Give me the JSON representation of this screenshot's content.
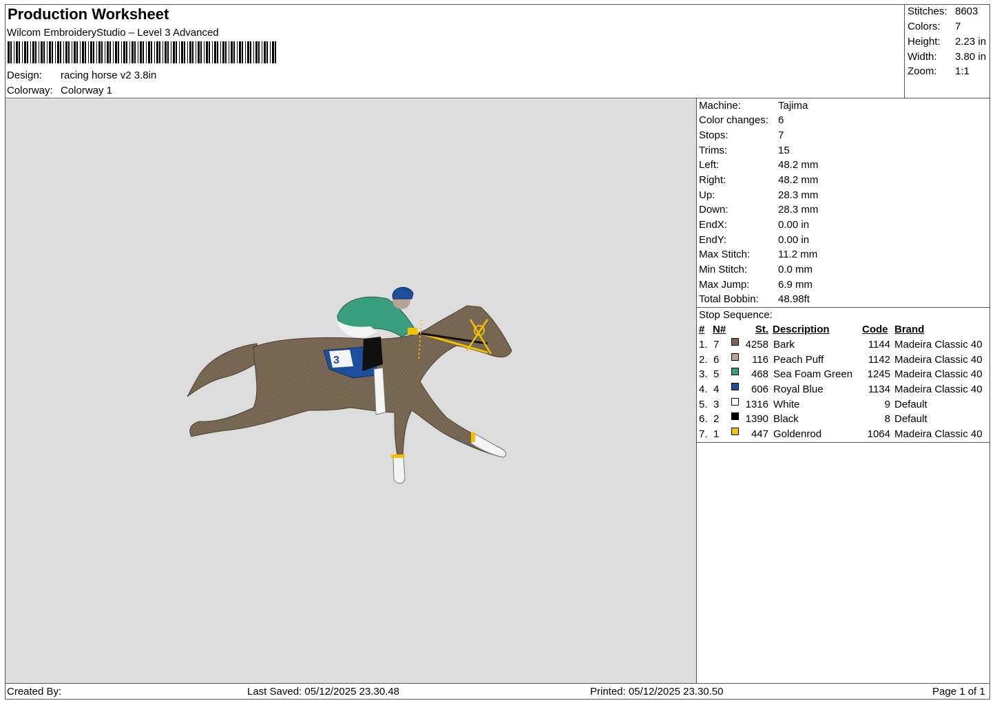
{
  "header": {
    "title": "Production Worksheet",
    "subtitle": "Wilcom EmbroideryStudio – Level 3 Advanced",
    "design_label": "Design:",
    "design_value": "racing horse v2 3.8in",
    "colorway_label": "Colorway:",
    "colorway_value": "Colorway 1"
  },
  "summary": [
    {
      "label": "Stitches:",
      "value": "8603"
    },
    {
      "label": "Colors:",
      "value": "7"
    },
    {
      "label": "Height:",
      "value": "2.23 in"
    },
    {
      "label": "Width:",
      "value": "3.80 in"
    },
    {
      "label": "Zoom:",
      "value": "1:1"
    }
  ],
  "machine_info": [
    {
      "label": "Machine:",
      "value": "Tajima"
    },
    {
      "label": "Color changes:",
      "value": "6"
    },
    {
      "label": "Stops:",
      "value": "7"
    },
    {
      "label": "Trims:",
      "value": "15"
    },
    {
      "label": "Left:",
      "value": "48.2 mm"
    },
    {
      "label": "Right:",
      "value": "48.2 mm"
    },
    {
      "label": "Up:",
      "value": "28.3 mm"
    },
    {
      "label": "Down:",
      "value": "28.3 mm"
    },
    {
      "label": "EndX:",
      "value": "0.00 in"
    },
    {
      "label": "EndY:",
      "value": "0.00 in"
    },
    {
      "label": "Max Stitch:",
      "value": "11.2 mm"
    },
    {
      "label": "Min Stitch:",
      "value": "0.0 mm"
    },
    {
      "label": "Max Jump:",
      "value": "6.9 mm"
    },
    {
      "label": "Total Bobbin:",
      "value": "48.98ft"
    }
  ],
  "stop_sequence": {
    "title": "Stop Sequence:",
    "headers": {
      "idx": "#",
      "n": "N#",
      "st": "St.",
      "description": "Description",
      "code": "Code",
      "brand": "Brand"
    },
    "rows": [
      {
        "idx": "1.",
        "n": "7",
        "color": "#7a6552",
        "st": "4258",
        "description": "Bark",
        "code": "1144",
        "brand": "Madeira Classic 40"
      },
      {
        "idx": "2.",
        "n": "6",
        "color": "#b9a194",
        "st": "116",
        "description": "Peach Puff",
        "code": "1142",
        "brand": "Madeira Classic 40"
      },
      {
        "idx": "3.",
        "n": "5",
        "color": "#3a9f7e",
        "st": "468",
        "description": "Sea Foam Green",
        "code": "1245",
        "brand": "Madeira Classic 40"
      },
      {
        "idx": "4.",
        "n": "4",
        "color": "#1d4f9a",
        "st": "606",
        "description": "Royal Blue",
        "code": "1134",
        "brand": "Madeira Classic 40"
      },
      {
        "idx": "5.",
        "n": "3",
        "color": "#ffffff",
        "st": "1316",
        "description": "White",
        "code": "9",
        "brand": "Default"
      },
      {
        "idx": "6.",
        "n": "2",
        "color": "#000000",
        "st": "1390",
        "description": "Black",
        "code": "8",
        "brand": "Default"
      },
      {
        "idx": "7.",
        "n": "1",
        "color": "#f2c200",
        "st": "447",
        "description": "Goldenrod",
        "code": "1064",
        "brand": "Madeira Classic 40"
      }
    ]
  },
  "footer": {
    "created_by": "Created By:",
    "last_saved": "Last Saved: 05/12/2025 23.30.48",
    "printed": "Printed: 05/12/2025 23.30.50",
    "page": "Page 1 of 1"
  }
}
